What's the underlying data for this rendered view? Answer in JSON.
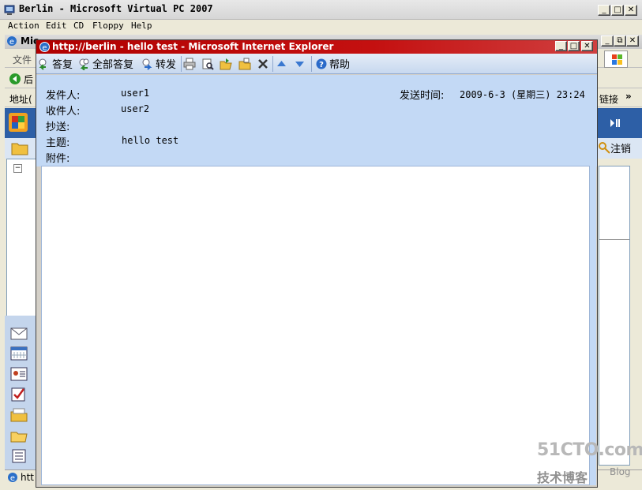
{
  "vpc": {
    "title": "Berlin - Microsoft Virtual PC 2007",
    "menu": [
      "Action",
      "Edit",
      "CD",
      "Floppy",
      "Help"
    ]
  },
  "background_window": {
    "title_fragment": "Mic",
    "menu_fragment": "文件",
    "back_fragment": "后",
    "address_fragment": "地址(",
    "links_label": "链接",
    "logoff_label": "注销",
    "status_fragment": "htt"
  },
  "ie": {
    "title": "http://berlin - hello test - Microsoft Internet Explorer",
    "toolbar": {
      "reply": "答复",
      "reply_all": "全部答复",
      "forward": "转发",
      "help": "帮助"
    }
  },
  "message": {
    "from_label": "发件人:",
    "from": "user1",
    "to_label": "收件人:",
    "to": "user2",
    "cc_label": "抄送:",
    "cc": "",
    "subject_label": "主题:",
    "subject": "hello test",
    "attach_label": "附件:",
    "sent_label": "发送时间:",
    "sent": "2009-6-3 (星期三) 23:24"
  },
  "watermark": {
    "brand": "51CTO.com",
    "tagline": "技术博客",
    "blog": "Blog"
  },
  "colors": {
    "ie_titlebar": "#c41010",
    "header_bg": "#c3d9f5",
    "owa_blue": "#2d5fa6"
  }
}
